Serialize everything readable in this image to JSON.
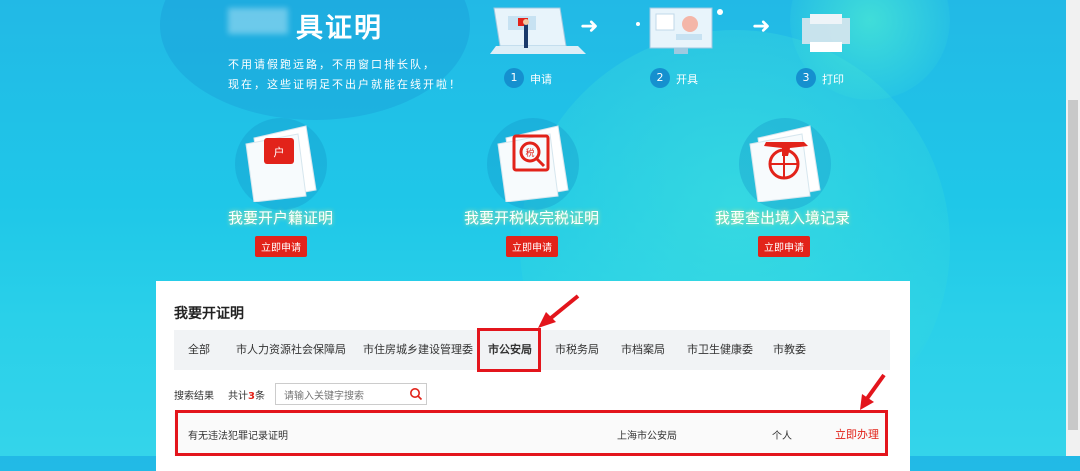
{
  "hero": {
    "title": "具证明",
    "desc_line1": "不用请假跑远路，不用窗口排长队，",
    "desc_line2": "现在，这些证明足不出户就能在线开啦！"
  },
  "steps": [
    {
      "num": "1",
      "label": "申请"
    },
    {
      "num": "2",
      "label": "开具"
    },
    {
      "num": "3",
      "label": "打印"
    }
  ],
  "cards": [
    {
      "label": "我要开户籍证明",
      "button": "立即申请",
      "icon": "household-register-icon",
      "icon_text": "户"
    },
    {
      "label": "我要开税收完税证明",
      "button": "立即申请",
      "icon": "tax-certificate-icon",
      "icon_text": "税"
    },
    {
      "label": "我要查出境入境记录",
      "button": "立即申请",
      "icon": "airplane-globe-icon",
      "icon_text": ""
    }
  ],
  "panel": {
    "title": "我要开证明",
    "tabs": [
      "全部",
      "市人力资源社会保障局",
      "市住房城乡建设管理委",
      "市公安局",
      "市税务局",
      "市档案局",
      "市卫生健康委",
      "市教委"
    ],
    "active_tab_index": 3,
    "search_label": "搜索结果",
    "count_prefix": "共计",
    "count": "3",
    "count_suffix": "条",
    "search_placeholder": "请输入关键字搜索"
  },
  "results": [
    {
      "name": "有无违法犯罪记录证明",
      "department": "上海市公安局",
      "target": "个人",
      "action": "立即办理"
    }
  ],
  "colors": {
    "accent_red": "#e2231a",
    "sky": "#22b9e6"
  }
}
